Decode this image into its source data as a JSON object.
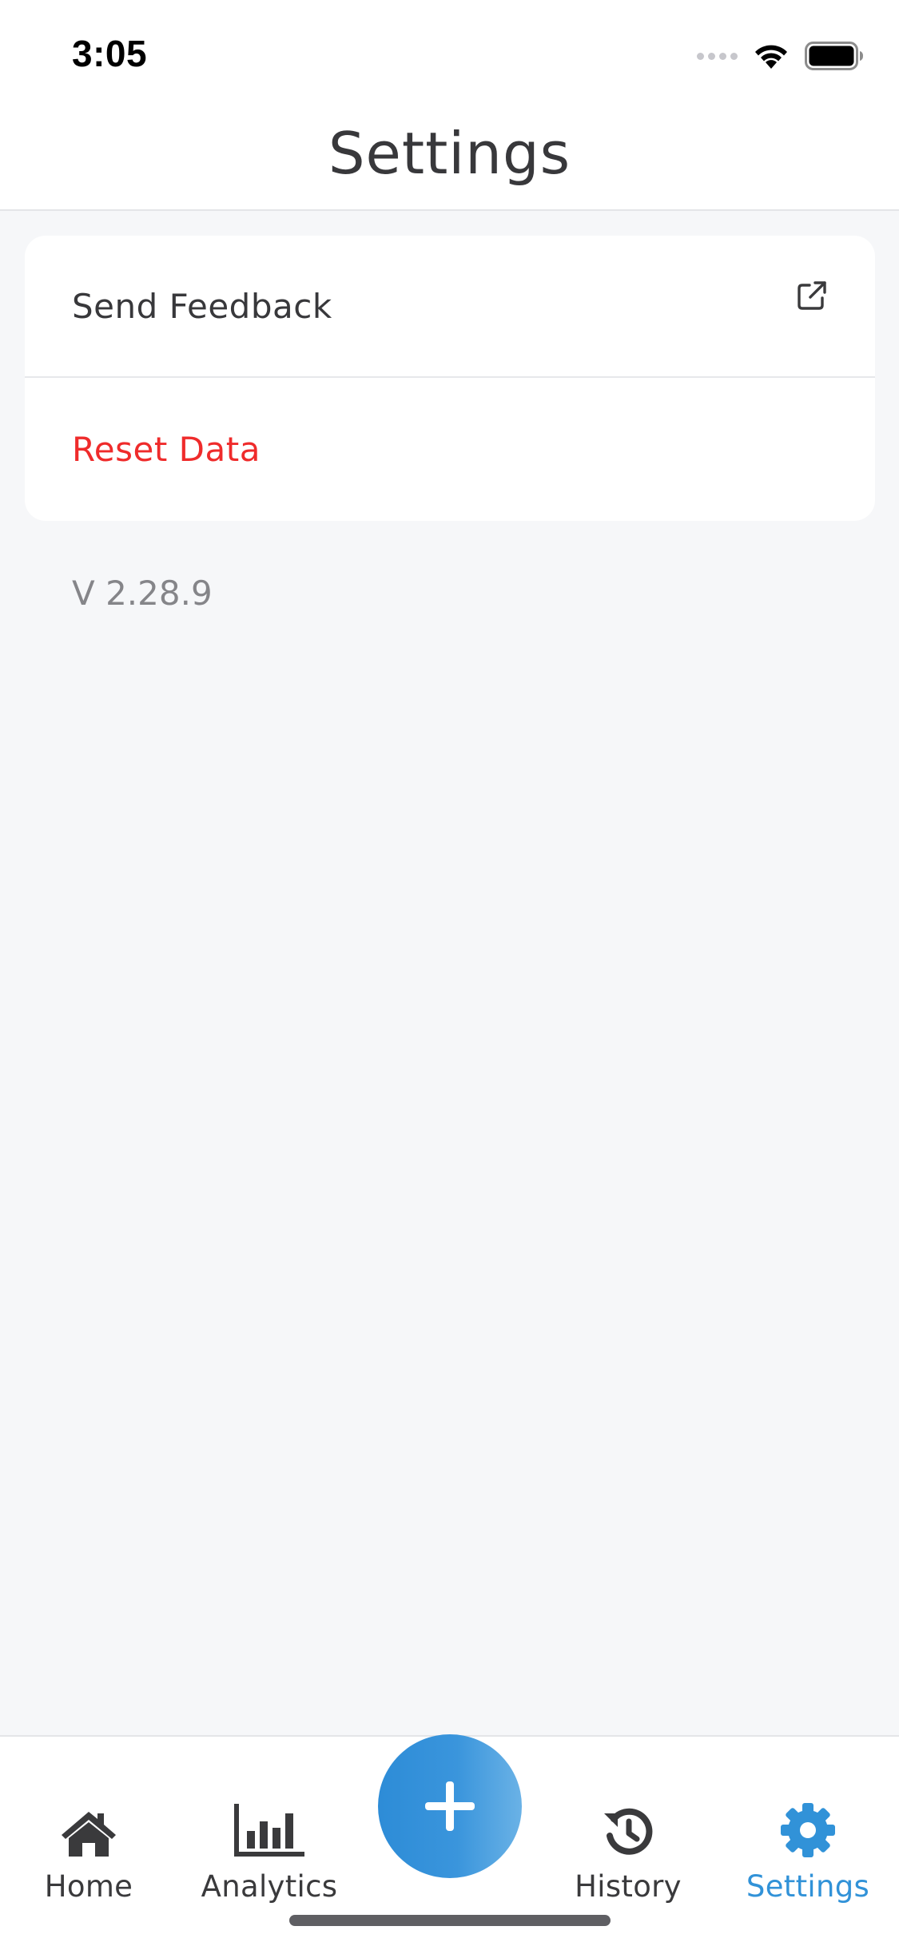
{
  "status_bar": {
    "time": "3:05"
  },
  "header": {
    "title": "Settings"
  },
  "settings": {
    "items": [
      {
        "label": "Send Feedback",
        "icon": "external-link-icon"
      },
      {
        "label": "Reset Data",
        "color": "#ef2b2b"
      }
    ],
    "version": "V 2.28.9"
  },
  "tab_bar": {
    "tabs": [
      {
        "label": "Home",
        "icon": "home-icon"
      },
      {
        "label": "Analytics",
        "icon": "bar-chart-icon"
      },
      {
        "label": "History",
        "icon": "history-icon"
      },
      {
        "label": "Settings",
        "icon": "gear-icon",
        "active": true
      }
    ],
    "fab_icon": "plus-icon"
  },
  "colors": {
    "accent": "#3192d8",
    "danger": "#ef2b2b",
    "background": "#f6f7f9",
    "text": "#38383b"
  }
}
